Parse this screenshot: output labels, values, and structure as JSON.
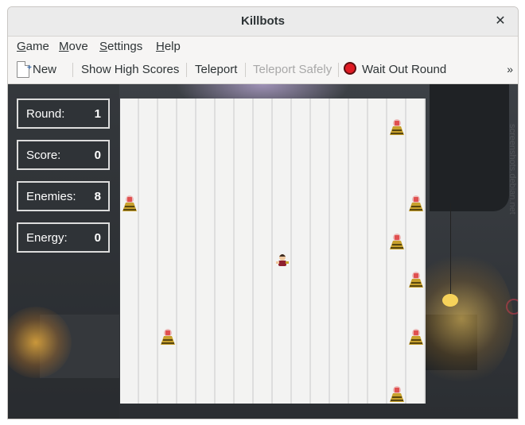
{
  "window": {
    "title": "Killbots"
  },
  "menu": [
    {
      "label": "Game",
      "mnemonic": "G"
    },
    {
      "label": "Move",
      "mnemonic": "M"
    },
    {
      "label": "Settings",
      "mnemonic": "S"
    },
    {
      "label": "Help",
      "mnemonic": "H"
    }
  ],
  "toolbar": {
    "new_label": "New",
    "high_scores_label": "Show High Scores",
    "teleport_label": "Teleport",
    "teleport_safely_label": "Teleport Safely",
    "wait_out_round_label": "Wait Out Round",
    "overflow_label": "»"
  },
  "stats": {
    "round_label": "Round:",
    "round_value": "1",
    "score_label": "Score:",
    "score_value": "0",
    "enemies_label": "Enemies:",
    "enemies_value": "8",
    "energy_label": "Energy:",
    "energy_value": "0"
  },
  "board": {
    "columns": 16,
    "rows": 16,
    "hero": {
      "col": 8,
      "row": 8
    },
    "robots": [
      {
        "col": 14,
        "row": 1
      },
      {
        "col": 0,
        "row": 5
      },
      {
        "col": 15,
        "row": 5
      },
      {
        "col": 14,
        "row": 7
      },
      {
        "col": 15,
        "row": 9
      },
      {
        "col": 2,
        "row": 12
      },
      {
        "col": 15,
        "row": 12
      },
      {
        "col": 14,
        "row": 15
      }
    ]
  },
  "watermark": "screenshots.debian.net",
  "colors": {
    "robot_body": "#c8a12c",
    "robot_warning": "#e05050",
    "hero_hair": "#3a2a20",
    "hero_shirt": "#8e2030"
  }
}
